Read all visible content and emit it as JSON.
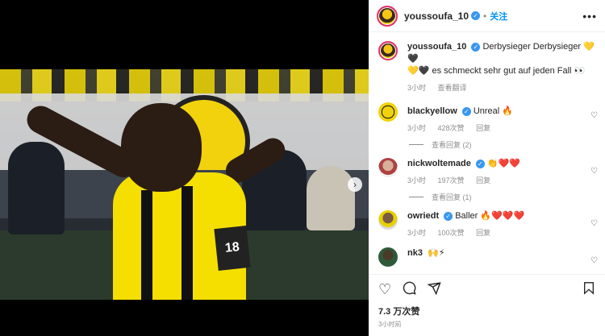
{
  "post": {
    "username": "youssoufa_10",
    "follow_label": "关注",
    "caption_line1": "Derbysieger Derbysieger 💛🖤",
    "caption_line2": "💛🖤 es schmeckt sehr gut auf jeden Fall 👀",
    "caption_time": "3小时",
    "translate_label": "查看翻译",
    "jersey_number": "18"
  },
  "comments": [
    {
      "user": "blackyellow",
      "text": "Unreal 🔥",
      "time": "3小时",
      "likes": "428次赞",
      "reply_label": "回复",
      "replies": "查看回复 (2)"
    },
    {
      "user": "nickwoltemade",
      "text": "👏❤️❤️",
      "time": "3小时",
      "likes": "197次赞",
      "reply_label": "回复",
      "replies": "查看回复 (1)"
    },
    {
      "user": "owriedt",
      "text": "Baller 🔥❤️❤️❤️",
      "time": "3小时",
      "likes": "100次赞",
      "reply_label": "回复",
      "replies": ""
    },
    {
      "user": "nk3",
      "text": "🙌⚡",
      "time": "",
      "likes": "",
      "reply_label": "",
      "replies": ""
    }
  ],
  "footer": {
    "likes": "7.3 万次赞",
    "time": "3小时前"
  },
  "icons": {
    "like": "heart-icon",
    "comment": "comment-icon",
    "share": "share-icon",
    "save": "bookmark-icon",
    "more": "more-options-icon",
    "next": "chevron-right-icon"
  },
  "colors": {
    "verified": "#3897f0",
    "follow": "#0095f6",
    "story_ring": "#e1306c",
    "bvb_yellow": "#f5df00"
  }
}
